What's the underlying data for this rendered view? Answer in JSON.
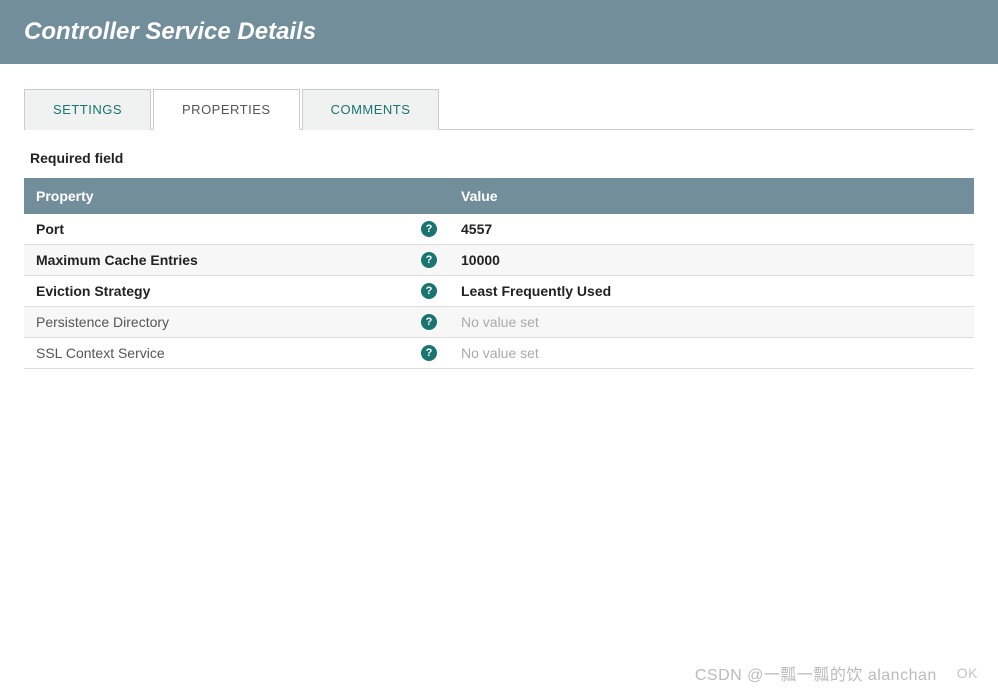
{
  "header": {
    "title": "Controller Service Details"
  },
  "tabs": {
    "settings": "SETTINGS",
    "properties": "PROPERTIES",
    "comments": "COMMENTS"
  },
  "required_label": "Required field",
  "table": {
    "headers": {
      "property": "Property",
      "value": "Value"
    },
    "rows": [
      {
        "name": "Port",
        "required": true,
        "value": "4557",
        "novalue": false
      },
      {
        "name": "Maximum Cache Entries",
        "required": true,
        "value": "10000",
        "novalue": false
      },
      {
        "name": "Eviction Strategy",
        "required": true,
        "value": "Least Frequently Used",
        "novalue": false
      },
      {
        "name": "Persistence Directory",
        "required": false,
        "value": "No value set",
        "novalue": true
      },
      {
        "name": "SSL Context Service",
        "required": false,
        "value": "No value set",
        "novalue": true
      }
    ]
  },
  "footer": {
    "watermark": "CSDN @一瓢一瓢的饮 alanchan",
    "ok": "OK"
  }
}
